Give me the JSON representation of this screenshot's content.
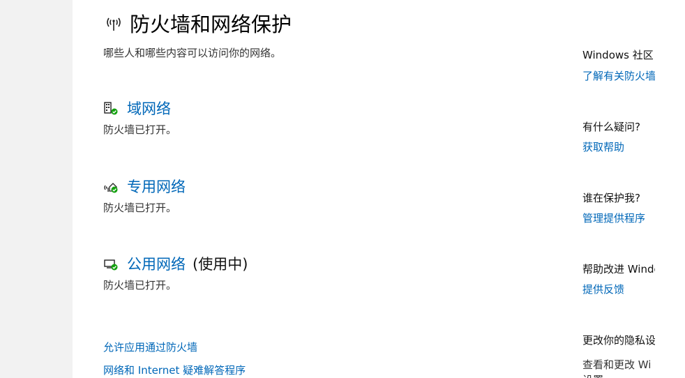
{
  "header": {
    "title": "防火墙和网络保护",
    "subtitle": "哪些人和哪些内容可以访问你的网络。",
    "icon": "wireless-antenna-icon"
  },
  "networks": [
    {
      "icon": "domain-network-icon",
      "label": "域网络",
      "suffix": "",
      "status": "防火墙已打开。"
    },
    {
      "icon": "private-network-icon",
      "label": "专用网络",
      "suffix": "",
      "status": "防火墙已打开。"
    },
    {
      "icon": "public-network-icon",
      "label": "公用网络",
      "suffix": "(使用中)",
      "status": "防火墙已打开。"
    }
  ],
  "links": {
    "allow_app": "允许应用通过防火墙",
    "troubleshooter": "网络和 Internet 疑难解答程序"
  },
  "sidebar": {
    "community_title": "Windows 社区",
    "community_link": "了解有关防火墙",
    "question_title": "有什么疑问?",
    "question_link": "获取帮助",
    "protect_title": "谁在保护我?",
    "protect_link": "管理提供程序",
    "improve_title": "帮助改进 Windows",
    "improve_link": "提供反馈",
    "privacy_title": "更改你的隐私设",
    "privacy_text": "查看和更改 Wi",
    "privacy_text2": "设置"
  },
  "colors": {
    "link": "#0067b8",
    "check": "#13a10e",
    "nav_bg": "#f2f2f2"
  }
}
